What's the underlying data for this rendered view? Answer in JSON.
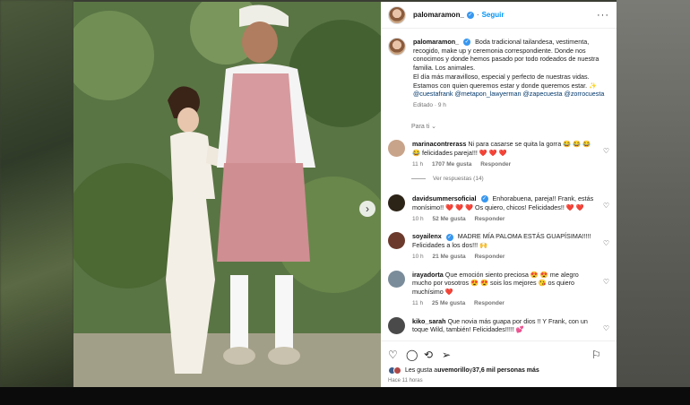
{
  "post": {
    "username": "palomaramon_",
    "follow_label": "Seguir",
    "more_label": "···",
    "caption": "Boda tradicional tailandesa, vestimenta, recogido, make up y ceremonia correspondiente. Donde nos conocimos y donde hemos pasado por todo rodeados de nuestra familia. Los animales.",
    "caption2": "El día más maravilloso, especial y perfecto de nuestras vidas. Estamos con quien queremos estar y donde queremos estar. ✨",
    "tags": "@cuestafrank @metapon_lawyerman @zapecuesta @zorrocuesta",
    "edited": "Editado · 9 h",
    "para_ti": "Para ti ⌄",
    "likes_prefix": "Les gusta a ",
    "likes_user": "uvemorillo",
    "likes_mid": " y ",
    "likes_count": "37,6 mil personas más",
    "time": "Hace 11 horas"
  },
  "comments": [
    {
      "user": "marinacontrerass",
      "text": "Ni para casarse se quita la gorra 😂 😂 😂 😂 felicidades pareja!!! ❤️ ❤️ ❤️",
      "time": "11 h",
      "likes": "1707 Me gusta",
      "reply": "Responder",
      "avatar_color": "#c8a48a"
    },
    {
      "user": "davidsummersoficial",
      "text": "Enhorabuena, pareja!! Frank, estás monísimo!! ❤️ ❤️ ❤️ Os quiero, chicos! Felicidades!! ❤️ ❤️",
      "time": "10 h",
      "likes": "52 Me gusta",
      "reply": "Responder",
      "avatar_color": "#2d2418"
    },
    {
      "user": "soyailenx",
      "text": "MADRE MÍA PALOMA ESTÁS GUAPÍSIMA!!!!! Felicidades a los dos!!! 🙌",
      "time": "10 h",
      "likes": "21 Me gusta",
      "reply": "Responder",
      "avatar_color": "#6b3a2c"
    },
    {
      "user": "irayadorta",
      "text": "Que emoción siento preciosa 😍 😍 me alegro mucho por vosotros 😍 😍 sois los mejores 😘 os quiero muchísimo ❤️",
      "time": "11 h",
      "likes": "25 Me gusta",
      "reply": "Responder",
      "avatar_color": "#7a8c9a"
    },
    {
      "user": "kiko_sarah",
      "text": "Que novia más guapa por dios !! Y Frank, con un toque Wild, también! Felicidades!!!!! 💕",
      "time": "",
      "likes": "",
      "reply": "",
      "avatar_color": "#4a4a4a"
    }
  ],
  "view_replies": "Ver respuestas (14)"
}
